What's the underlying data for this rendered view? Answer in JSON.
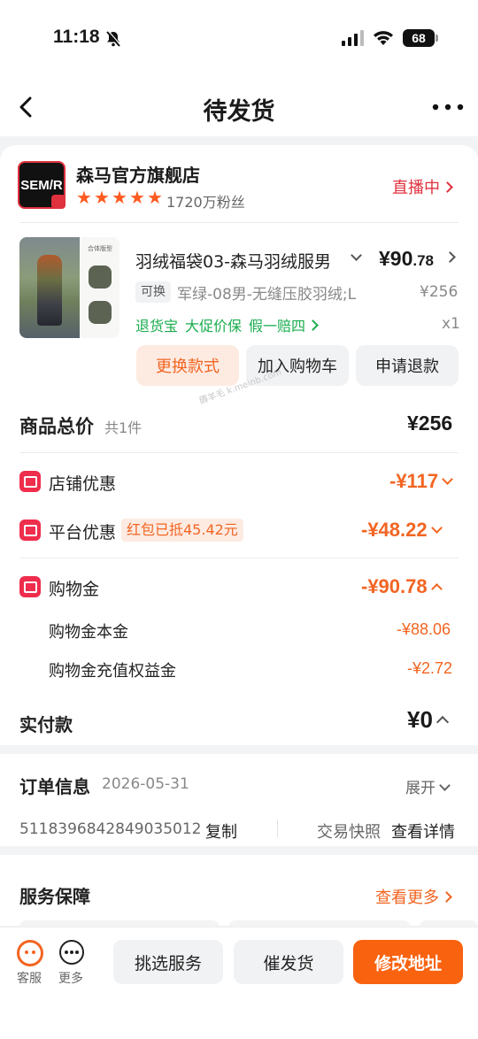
{
  "status": {
    "time": "11:18",
    "battery": "68"
  },
  "header": {
    "title": "待发货"
  },
  "shop": {
    "logo": "SEM/R",
    "name": "森马官方旗舰店",
    "fans": "1720万粉丝",
    "rating": 5,
    "live": "直播中"
  },
  "product": {
    "title": "羽绒福袋03-森马羽绒服男",
    "price_int": "¥90",
    "price_dec": ".78",
    "exchange_tag": "可换",
    "spec": "军绿-08男-无缝压胶羽绒;L",
    "original_price": "¥256",
    "tags": [
      "退货宝",
      "大促价保",
      "假一赔四"
    ],
    "qty": "x1",
    "image_caption": "合体版型"
  },
  "actions": {
    "change": "更换款式",
    "cart": "加入购物车",
    "refund": "申请退款"
  },
  "watermark": "薅羊毛 k.meinb.com",
  "summary": {
    "total_label": "商品总价",
    "total_count": "共1件",
    "total_value": "¥256",
    "shop_discount_label": "店铺优惠",
    "shop_discount_value": "-¥117",
    "platform_discount_label": "平台优惠",
    "platform_redpack": "红包已抵45.42元",
    "platform_discount_value": "-¥48.22",
    "shopping_money_label": "购物金",
    "shopping_money_value": "-¥90.78",
    "principal_label": "购物金本金",
    "principal_value": "-¥88.06",
    "bonus_label": "购物金充值权益金",
    "bonus_value": "-¥2.72",
    "paid_label": "实付款",
    "paid_value": "¥0"
  },
  "order": {
    "label": "订单信息",
    "date": "2026-05-31",
    "expand": "展开",
    "number": "5118396842849035012",
    "copy": "复制",
    "snapshot": "交易快照",
    "detail": "查看详情"
  },
  "service": {
    "label": "服务保障",
    "more": "查看更多"
  },
  "bottom": {
    "kefu": "客服",
    "more": "更多",
    "pick": "挑选服务",
    "urge": "催发货",
    "address": "修改地址"
  },
  "colors": {
    "accent": "#f26522",
    "primary_button": "#f9620f",
    "live": "#e0313e",
    "green": "#1aad4e"
  }
}
